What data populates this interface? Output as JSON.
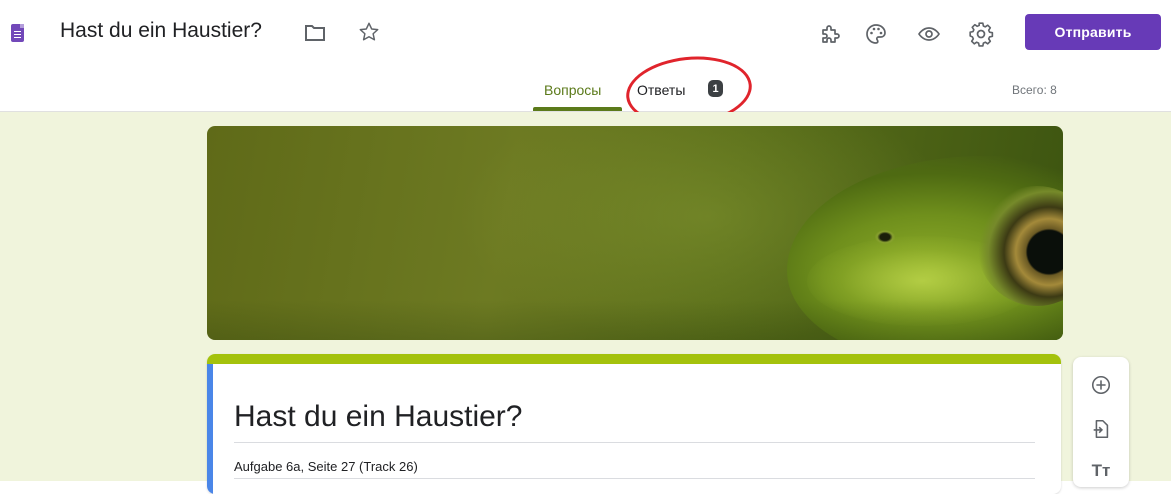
{
  "header": {
    "app_icon": "google-forms-icon",
    "title": "Hast du ein Haustier?",
    "icons": [
      "folder-icon",
      "star-icon",
      "addon-icon",
      "palette-icon",
      "preview-icon",
      "settings-icon"
    ],
    "send_label": "Отправить",
    "accent_color": "#673ab7"
  },
  "tabs": {
    "questions_label": "Вопросы",
    "responses_label": "Ответы",
    "responses_count": "1",
    "total_label": "Всего: 8",
    "active_color": "#5b7a1a"
  },
  "annotation": {
    "highlight": "red-circle",
    "color": "#e0242c"
  },
  "banner": {
    "image": "frog-photo"
  },
  "form": {
    "title": "Hast du ein Haustier?",
    "description": "Aufgabe 6a, Seite 27 (Track 26)",
    "theme_color": "#a4c20c",
    "background_color": "#f0f4dc"
  },
  "toolbar": {
    "tools": [
      "add-question-icon",
      "import-questions-icon",
      "add-title-icon"
    ],
    "title_tool_glyph": "Tт"
  }
}
